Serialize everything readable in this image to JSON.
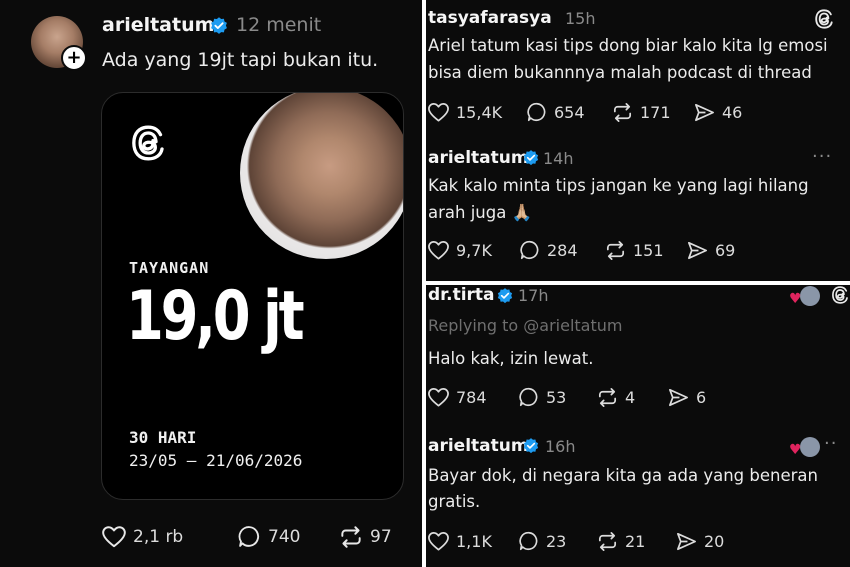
{
  "main_post": {
    "username": "arieltatum",
    "time": "12 menit",
    "text": "Ada yang 19jt tapi bukan itu.",
    "card": {
      "label": "TAYANGAN",
      "value": "19,0 jt",
      "period": "30 HARI",
      "range": "23/05 — 21/06/2026"
    },
    "stats": {
      "likes": "2,1 rb",
      "replies": "740",
      "reposts": "97"
    }
  },
  "thread_top": {
    "post1": {
      "username": "tasyafarasya",
      "time": "15h",
      "line1": "Ariel tatum kasi tips dong biar kalo kita lg emosi",
      "line2": "bisa diem bukannnya malah podcast di thread",
      "stats": {
        "likes": "15,4K",
        "replies": "654",
        "reposts": "171",
        "shares": "46"
      }
    },
    "post2": {
      "username": "arieltatum",
      "time": "14h",
      "line1": "Kak kalo minta tips jangan ke yang lagi hilang",
      "line2": "arah juga 🙏🏼",
      "stats": {
        "likes": "9,7K",
        "replies": "284",
        "reposts": "151",
        "shares": "69"
      }
    }
  },
  "thread_bottom": {
    "post1": {
      "username": "dr.tirta",
      "time": "17h",
      "replying": "Replying to @arieltatum",
      "text": "Halo kak, izin lewat.",
      "stats": {
        "likes": "784",
        "replies": "53",
        "reposts": "4",
        "shares": "6"
      }
    },
    "post2": {
      "username": "arieltatum",
      "time": "16h",
      "line1": "Bayar dok, di negara kita ga ada yang beneran",
      "line2": "gratis.",
      "stats": {
        "likes": "1,1K",
        "replies": "23",
        "reposts": "21",
        "shares": "20"
      }
    }
  },
  "colors": {
    "verified": "#1d9bf0",
    "background": "#0b0b0b",
    "heart": "#e0245e"
  }
}
